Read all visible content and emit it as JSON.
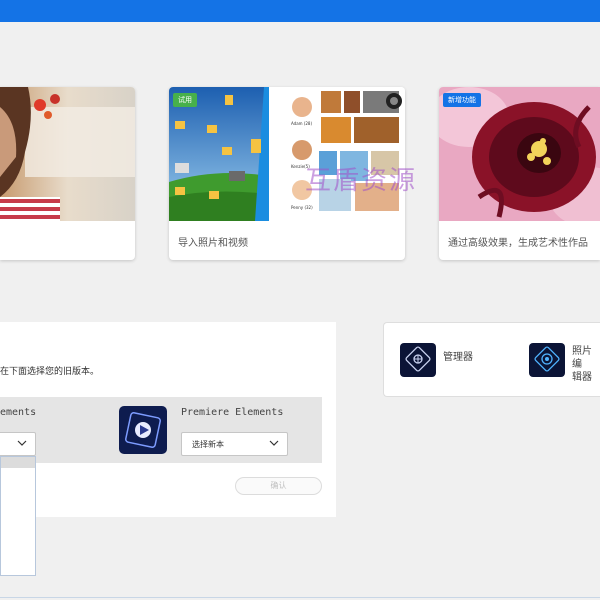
{
  "cards": [
    {
      "caption": ""
    },
    {
      "badge": "试用",
      "caption": "导入照片和视频",
      "thumb_labels": {
        "adam": "Adam (28)",
        "kenzie": "Kenzie(5)",
        "penny": "Penny (32)"
      }
    },
    {
      "badge": "新增功能",
      "caption": "通过高级效果，生成艺术性作品"
    }
  ],
  "watermark": "互盾资源",
  "install_panel": {
    "hint": "在下面选择您的旧版本。",
    "left_product_label": "ements",
    "right_product_label": "Premiere Elements",
    "right_select_value": "选择新本",
    "confirm_label": "确认"
  },
  "apps": [
    {
      "label": "管理器",
      "icon": "organizer-icon"
    },
    {
      "label": "照片编辑器",
      "label_line1": "照片编",
      "label_line2": "辑器",
      "icon": "photo-editor-icon"
    }
  ],
  "colors": {
    "accent": "#1473e6",
    "trial": "#47b04b"
  }
}
